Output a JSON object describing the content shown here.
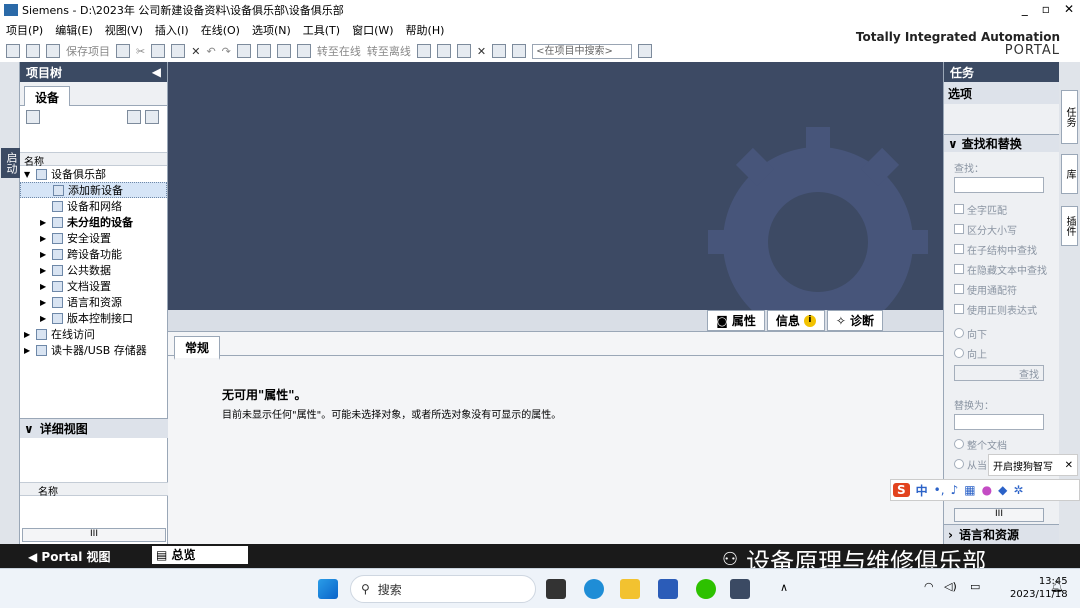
{
  "title_bar": {
    "app": "Siemens",
    "path": "D:\\2023年 公司新建设备资料\\设备俱乐部\\设备俱乐部",
    "controls": [
      "_",
      "▫",
      "✕"
    ]
  },
  "menu": [
    "项目(P)",
    "编辑(E)",
    "视图(V)",
    "插入(I)",
    "在线(O)",
    "选项(N)",
    "工具(T)",
    "窗口(W)",
    "帮助(H)"
  ],
  "toolbar": {
    "save_project": "保存项目",
    "go_online": "转至在线",
    "go_offline": "转至离线",
    "search_placeholder": "<在项目中搜索>"
  },
  "brand": {
    "line1": "Totally Integrated Automation",
    "line2": "PORTAL"
  },
  "left_strip": {
    "label": "启动"
  },
  "project_tree": {
    "header": "项目树",
    "tab": "设备",
    "column": "名称",
    "items": [
      {
        "label": "设备俱乐部",
        "level": 0,
        "arrow": "▼"
      },
      {
        "label": "添加新设备",
        "level": 1,
        "arrow": "",
        "selected": true
      },
      {
        "label": "设备和网络",
        "level": 1,
        "arrow": ""
      },
      {
        "label": "未分组的设备",
        "level": 1,
        "arrow": "▶",
        "bold": true
      },
      {
        "label": "安全设置",
        "level": 1,
        "arrow": "▶"
      },
      {
        "label": "跨设备功能",
        "level": 1,
        "arrow": "▶"
      },
      {
        "label": "公共数据",
        "level": 1,
        "arrow": "▶"
      },
      {
        "label": "文档设置",
        "level": 1,
        "arrow": "▶"
      },
      {
        "label": "语言和资源",
        "level": 1,
        "arrow": "▶"
      },
      {
        "label": "版本控制接口",
        "level": 1,
        "arrow": "▶"
      },
      {
        "label": "在线访问",
        "level": 0,
        "arrow": "▶"
      },
      {
        "label": "读卡器/USB 存储器",
        "level": 0,
        "arrow": "▶"
      }
    ],
    "detail_view": "详细视图",
    "detail_column": "名称",
    "scroll_grip": "III"
  },
  "properties": {
    "tabs": [
      "属性",
      "信息",
      "诊断"
    ],
    "sub_tab": "常规",
    "message_title": "无可用\"属性\"。",
    "message_body": "目前未显示任何\"属性\"。可能未选择对象，或者所选对象没有可显示的属性。"
  },
  "tasks_panel": {
    "header": "任务",
    "options": "选项",
    "find_replace": "查找和替换",
    "find_label": "查找：",
    "checks": [
      "全字匹配",
      "区分大小写",
      "在子结构中查找",
      "在隐藏文本中查找",
      "使用通配符",
      "使用正则表达式"
    ],
    "dir_down": "向下",
    "dir_up": "向上",
    "find_button": "查找",
    "replace_label": "替换为：",
    "scope_whole": "整个文档",
    "scope_from": "从当",
    "lang_resources": "语言和资源",
    "scroll_grip": "III"
  },
  "right_strip": [
    "任务",
    "库",
    "插件"
  ],
  "status_bar": {
    "portal_view": "Portal 视图",
    "overview": "总览"
  },
  "ime": {
    "tip": "开启搜狗智写",
    "mode": "中"
  },
  "watermark": "设备原理与维修俱乐部",
  "taskbar": {
    "search": "搜索",
    "time": "13:45",
    "date": "2023/11/18"
  }
}
